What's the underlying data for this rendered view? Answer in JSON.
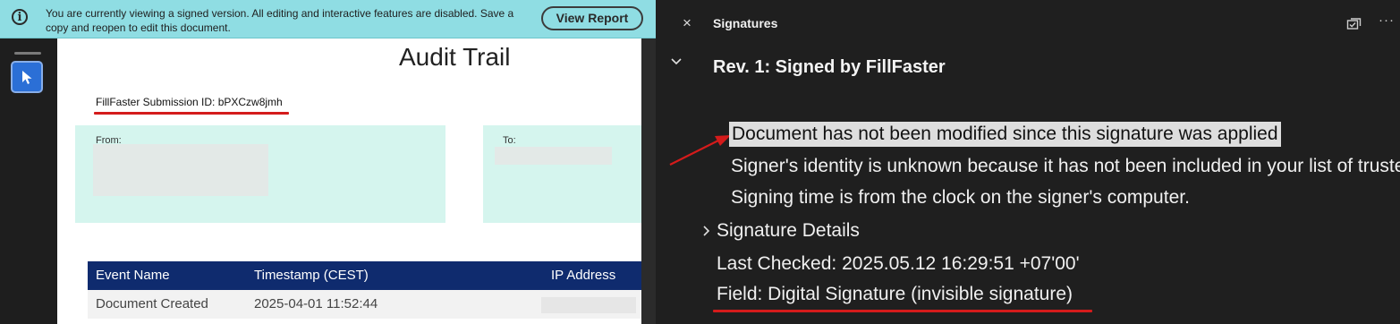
{
  "notice": {
    "text": "You are currently viewing a signed version. All editing and interactive features are disabled. Save a copy and reopen to edit this document.",
    "button": "View Report",
    "info_symbol": "i"
  },
  "document": {
    "title": "Audit Trail",
    "submission_id": "FillFaster Submission ID: bPXCzw8jmh",
    "from_label": "From:",
    "to_label": "To:",
    "table": {
      "headers": [
        "Event Name",
        "Timestamp (CEST)",
        "IP Address"
      ],
      "rows": [
        [
          "Document Created",
          "2025-04-01 11:52:44",
          ""
        ]
      ]
    }
  },
  "panel": {
    "title": "Signatures",
    "close_symbol": "×",
    "more_symbol": "···",
    "revision": "Rev. 1: Signed by FillFaster",
    "status": [
      "Document has not been modified since this signature was applied",
      "Signer's identity is unknown because it has not been included in your list of trusted certificates",
      "Signing time is from the clock on the signer's computer."
    ],
    "details_label": "Signature Details",
    "last_checked": "Last Checked: 2025.05.12 16:29:51 +07'00'",
    "field": "Field: Digital Signature (invisible signature)"
  },
  "icons": {
    "info": "info-icon",
    "select_tool": "cursor-arrow-icon",
    "close": "close-icon",
    "panel_options": "panel-options-icon",
    "more": "more-icon",
    "chevron_down": "chevron-down-icon",
    "chevron_right": "chevron-right-icon"
  },
  "colors": {
    "notice_bg": "#8fdde3",
    "header_navy": "#0f2b6e",
    "annotation_red": "#d41b1b",
    "tool_blue": "#2b6fd6",
    "panel_bg": "#1f1f1f"
  }
}
